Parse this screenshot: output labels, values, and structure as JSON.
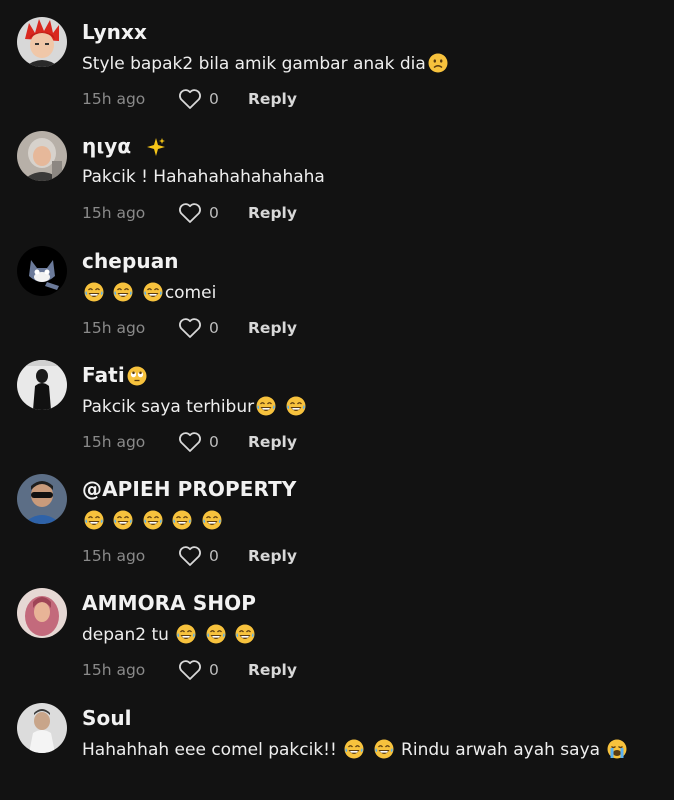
{
  "comments": [
    {
      "username": "Lynxx",
      "text": "Style bapak2 bila amik gambar anak dia",
      "text_emojis": [
        "frown"
      ],
      "time": "15h ago",
      "likes": "0",
      "reply_label": "Reply",
      "avatar_icon": "anime-avatar-red-hair"
    },
    {
      "username": "ηιуα",
      "username_emojis": [
        "sparkles"
      ],
      "text": "Pakcik ! Hahahahahahahaha",
      "time": "15h ago",
      "likes": "0",
      "reply_label": "Reply",
      "avatar_icon": "woman-hijab-photo"
    },
    {
      "username": "chepuan",
      "text_before": "",
      "text_emojis": [
        "laugh",
        "laugh",
        "laugh"
      ],
      "text": "comei",
      "time": "15h ago",
      "likes": "0",
      "reply_label": "Reply",
      "avatar_icon": "cartoon-cat"
    },
    {
      "username": "Fati",
      "username_emojis": [
        "eye-roll"
      ],
      "text": "Pakcik saya terhibur",
      "text_emojis": [
        "laugh",
        "laugh"
      ],
      "time": "15h ago",
      "likes": "0",
      "reply_label": "Reply",
      "avatar_icon": "person-in-black-photo"
    },
    {
      "username": "@APIEH PROPERTY",
      "text": "",
      "text_emojis": [
        "laugh",
        "laugh",
        "laugh",
        "laugh",
        "laugh"
      ],
      "time": "15h ago",
      "likes": "0",
      "reply_label": "Reply",
      "avatar_icon": "man-sunglasses-photo"
    },
    {
      "username": "AMMORA SHOP",
      "text": "depan2 tu",
      "text_emojis": [
        "laugh",
        "laugh",
        "laugh"
      ],
      "time": "15h ago",
      "likes": "0",
      "reply_label": "Reply",
      "avatar_icon": "woman-pink-hijab-photo"
    },
    {
      "username": "Soul",
      "text": "Hahahhah eee comel pakcik!!",
      "text_emojis": [
        "laugh",
        "laugh"
      ],
      "text_after": "Rindu arwah ayah saya",
      "text_after_emojis": [
        "cry"
      ],
      "avatar_icon": "child-photo"
    }
  ],
  "colors": {
    "background": "#121212",
    "username": "#f2f2f2",
    "time": "#8a8a8a",
    "reply": "#d8d8d8"
  }
}
